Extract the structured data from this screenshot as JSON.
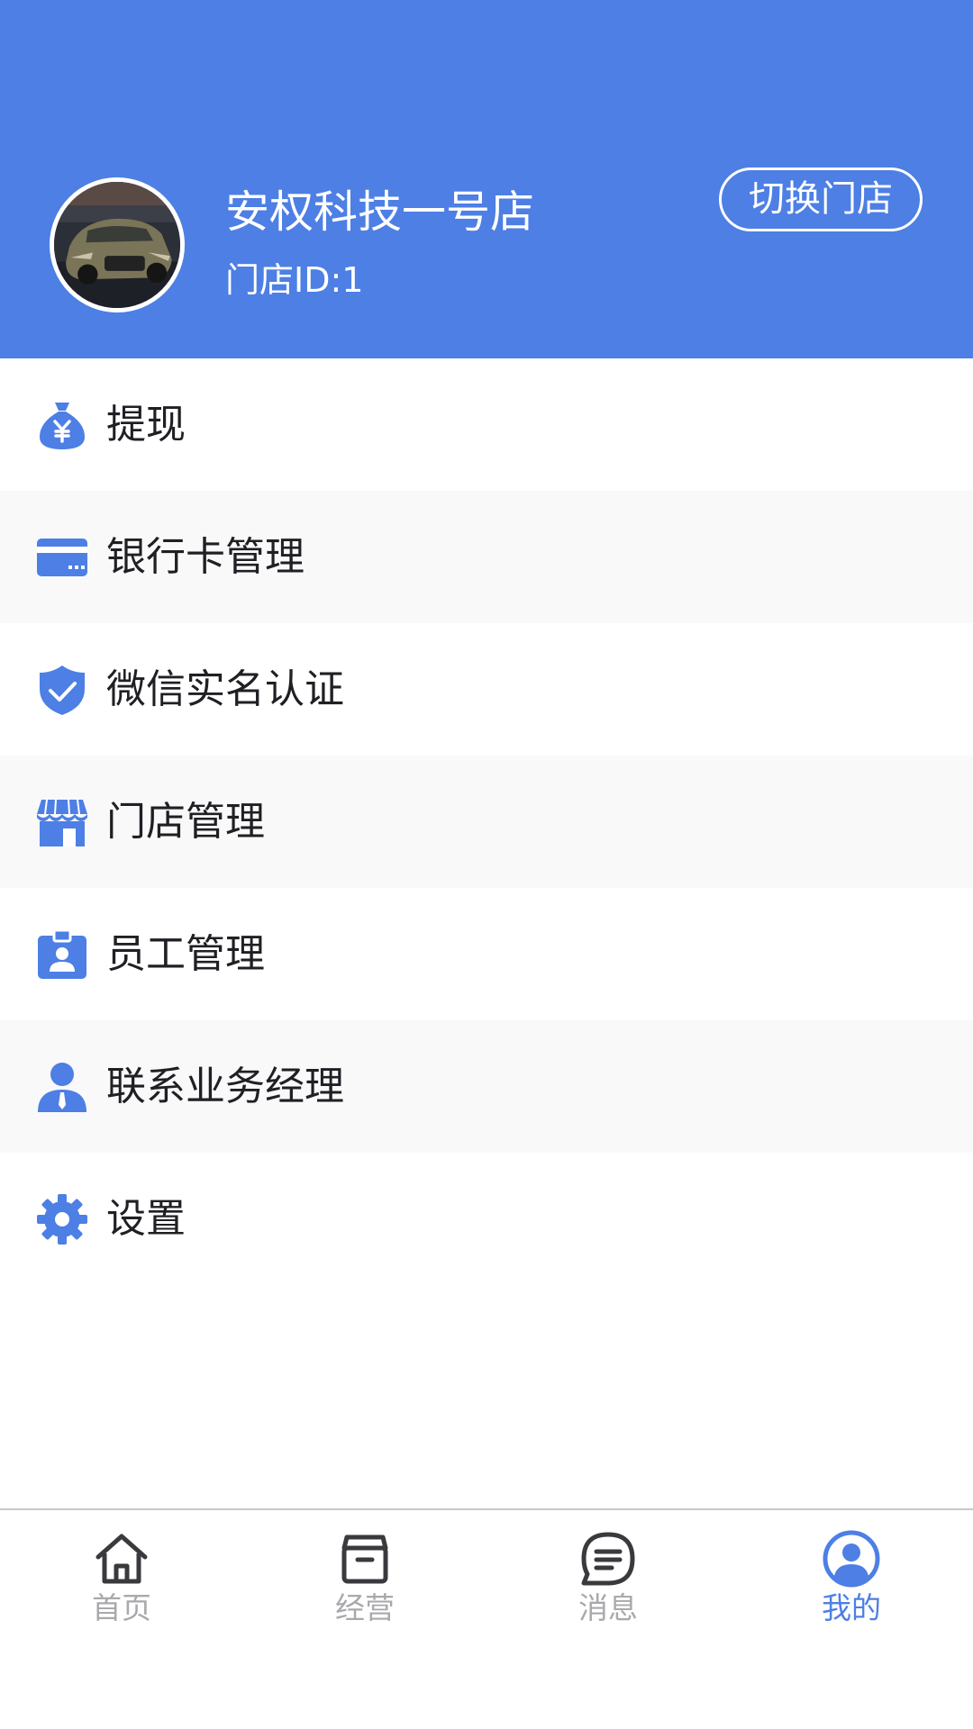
{
  "header": {
    "store_name": "安权科技一号店",
    "store_id": "门店ID:1",
    "switch_store_label": "切换门店",
    "background_color": "#4d7fe5"
  },
  "menu": {
    "items": [
      {
        "label": "提现",
        "icon": "money-bag-icon"
      },
      {
        "label": "银行卡管理",
        "icon": "bank-card-icon"
      },
      {
        "label": "微信实名认证",
        "icon": "shield-check-icon"
      },
      {
        "label": "门店管理",
        "icon": "storefront-icon"
      },
      {
        "label": "员工管理",
        "icon": "employee-badge-icon"
      },
      {
        "label": "联系业务经理",
        "icon": "manager-person-icon"
      },
      {
        "label": "设置",
        "icon": "gear-icon"
      }
    ],
    "icon_color": "#4d7fe5"
  },
  "tabbar": {
    "tabs": [
      {
        "label": "首页",
        "icon": "home-icon",
        "active": false
      },
      {
        "label": "经营",
        "icon": "box-icon",
        "active": false
      },
      {
        "label": "消息",
        "icon": "message-icon",
        "active": false
      },
      {
        "label": "我的",
        "icon": "profile-icon",
        "active": true
      }
    ],
    "active_color": "#4d7fe5",
    "inactive_color": "#a9a9ad"
  }
}
